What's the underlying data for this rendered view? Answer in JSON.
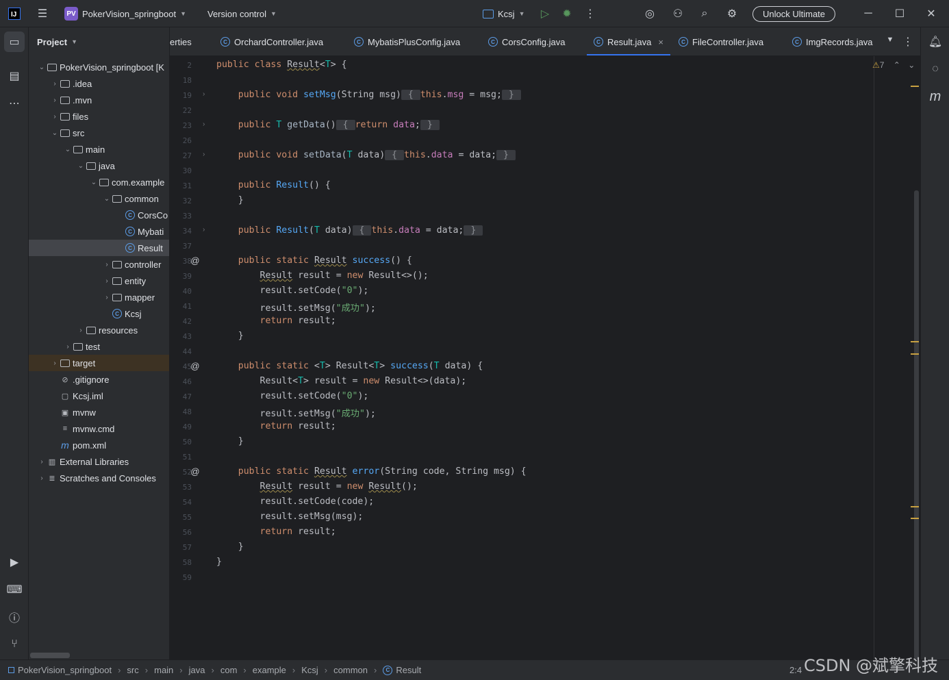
{
  "titlebar": {
    "project_badge": "PV",
    "project_name": "PokerVision_springboot",
    "vcs": "Version control",
    "run_config": "Kcsj",
    "unlock": "Unlock Ultimate"
  },
  "project_panel": {
    "title": "Project",
    "tree": [
      {
        "label": "PokerVision_springboot [K",
        "arrow": "open",
        "icon": "module",
        "indent": 0
      },
      {
        "label": ".idea",
        "arrow": "closed",
        "icon": "folder",
        "indent": 1
      },
      {
        "label": ".mvn",
        "arrow": "closed",
        "icon": "folder",
        "indent": 1
      },
      {
        "label": "files",
        "arrow": "closed",
        "icon": "folder",
        "indent": 1
      },
      {
        "label": "src",
        "arrow": "open",
        "icon": "folder",
        "indent": 1
      },
      {
        "label": "main",
        "arrow": "open",
        "icon": "folder",
        "indent": 2
      },
      {
        "label": "java",
        "arrow": "open",
        "icon": "folder",
        "indent": 3
      },
      {
        "label": "com.example",
        "arrow": "open",
        "icon": "package",
        "indent": 4
      },
      {
        "label": "common",
        "arrow": "open",
        "icon": "package",
        "indent": 5
      },
      {
        "label": "CorsCo",
        "arrow": "none",
        "icon": "class",
        "indent": 6
      },
      {
        "label": "Mybati",
        "arrow": "none",
        "icon": "class",
        "indent": 6
      },
      {
        "label": "Result",
        "arrow": "none",
        "icon": "class",
        "indent": 6,
        "selected": true
      },
      {
        "label": "controller",
        "arrow": "closed",
        "icon": "package",
        "indent": 5
      },
      {
        "label": "entity",
        "arrow": "closed",
        "icon": "package",
        "indent": 5
      },
      {
        "label": "mapper",
        "arrow": "closed",
        "icon": "package",
        "indent": 5
      },
      {
        "label": "Kcsj",
        "arrow": "none",
        "icon": "class",
        "indent": 5
      },
      {
        "label": "resources",
        "arrow": "closed",
        "icon": "folder",
        "indent": 3
      },
      {
        "label": "test",
        "arrow": "closed",
        "icon": "folder",
        "indent": 2
      },
      {
        "label": "target",
        "arrow": "closed",
        "icon": "folder",
        "indent": 1,
        "excluded": true
      },
      {
        "label": ".gitignore",
        "arrow": "none",
        "icon": "ignore",
        "indent": 1
      },
      {
        "label": "Kcsj.iml",
        "arrow": "none",
        "icon": "file",
        "indent": 1
      },
      {
        "label": "mvnw",
        "arrow": "none",
        "icon": "shell",
        "indent": 1
      },
      {
        "label": "mvnw.cmd",
        "arrow": "none",
        "icon": "text",
        "indent": 1
      },
      {
        "label": "pom.xml",
        "arrow": "none",
        "icon": "maven",
        "indent": 1
      },
      {
        "label": "External Libraries",
        "arrow": "closed",
        "icon": "library",
        "indent": 0
      },
      {
        "label": "Scratches and Consoles",
        "arrow": "closed",
        "icon": "scratch",
        "indent": 0
      }
    ]
  },
  "tabs": [
    {
      "label": "erties",
      "active": false
    },
    {
      "label": "OrchardController.java",
      "active": false
    },
    {
      "label": "MybatisPlusConfig.java",
      "active": false
    },
    {
      "label": "CorsConfig.java",
      "active": false
    },
    {
      "label": "Result.java",
      "active": true
    },
    {
      "label": "FileController.java",
      "active": false
    },
    {
      "label": "ImgRecords.java",
      "active": false
    }
  ],
  "editor": {
    "warning_count": "7",
    "lines": [
      {
        "n": "2",
        "fold": "",
        "at": false,
        "html": "<span class='kw'>public class</span> <span class='ul'>Result</span>&lt;<span class='tp'>T</span>&gt; {"
      },
      {
        "n": "18",
        "fold": "",
        "at": false,
        "html": ""
      },
      {
        "n": "19",
        "fold": "›",
        "at": false,
        "html": "    <span class='kw'>public void</span> <span class='fn'>setMsg</span>(String msg)<span class='fold-blk'> { </span><span class='kw'>this</span>.<span class='fld'>msg</span> = msg;<span class='fold-blk'> } </span>"
      },
      {
        "n": "22",
        "fold": "",
        "at": false,
        "html": ""
      },
      {
        "n": "23",
        "fold": "›",
        "at": false,
        "html": "    <span class='kw'>public</span> <span class='tp'>T</span> <span class='dim'>getData</span>()<span class='fold-blk'> { </span><span class='kw'>return</span> <span class='fld'>data</span>;<span class='fold-blk'> } </span>"
      },
      {
        "n": "26",
        "fold": "",
        "at": false,
        "html": ""
      },
      {
        "n": "27",
        "fold": "›",
        "at": false,
        "html": "    <span class='kw'>public void</span> <span class='dim'>setData</span>(<span class='tp'>T</span> data)<span class='fold-blk'> { </span><span class='kw'>this</span>.<span class='fld'>data</span> = data;<span class='fold-blk'> } </span>"
      },
      {
        "n": "30",
        "fold": "",
        "at": false,
        "html": ""
      },
      {
        "n": "31",
        "fold": "",
        "at": false,
        "html": "    <span class='kw'>public</span> <span class='fn'>Result</span>() {"
      },
      {
        "n": "32",
        "fold": "",
        "at": false,
        "html": "    }"
      },
      {
        "n": "33",
        "fold": "",
        "at": false,
        "html": ""
      },
      {
        "n": "34",
        "fold": "›",
        "at": false,
        "html": "    <span class='kw'>public</span> <span class='fn'>Result</span>(<span class='tp'>T</span> data)<span class='fold-blk'> { </span><span class='kw'>this</span>.<span class='fld'>data</span> = data;<span class='fold-blk'> } </span>"
      },
      {
        "n": "37",
        "fold": "",
        "at": false,
        "html": ""
      },
      {
        "n": "38",
        "fold": "",
        "at": true,
        "html": "    <span class='kw'>public static</span> <span class='ul'>Result</span> <span class='fn'>success</span>() {"
      },
      {
        "n": "39",
        "fold": "",
        "at": false,
        "html": "        <span class='ul'>Result</span> result = <span class='kw'>new</span> Result&lt;&gt;();"
      },
      {
        "n": "40",
        "fold": "",
        "at": false,
        "html": "        result.setCode(<span class='str'>\"0\"</span>);"
      },
      {
        "n": "41",
        "fold": "",
        "at": false,
        "html": "        result.setMsg(<span class='str'>\"成功\"</span>);"
      },
      {
        "n": "42",
        "fold": "",
        "at": false,
        "html": "        <span class='kw'>return</span> result;"
      },
      {
        "n": "43",
        "fold": "",
        "at": false,
        "html": "    }"
      },
      {
        "n": "44",
        "fold": "",
        "at": false,
        "html": ""
      },
      {
        "n": "45",
        "fold": "",
        "at": true,
        "html": "    <span class='kw'>public static</span> &lt;<span class='tp'>T</span>&gt; Result&lt;<span class='tp'>T</span>&gt; <span class='fn'>success</span>(<span class='tp'>T</span> data) {"
      },
      {
        "n": "46",
        "fold": "",
        "at": false,
        "html": "        Result&lt;<span class='tp'>T</span>&gt; result = <span class='kw'>new</span> Result&lt;&gt;(data);"
      },
      {
        "n": "47",
        "fold": "",
        "at": false,
        "html": "        result.setCode(<span class='str'>\"0\"</span>);"
      },
      {
        "n": "48",
        "fold": "",
        "at": false,
        "html": "        result.setMsg(<span class='str'>\"成功\"</span>);"
      },
      {
        "n": "49",
        "fold": "",
        "at": false,
        "html": "        <span class='kw'>return</span> result;"
      },
      {
        "n": "50",
        "fold": "",
        "at": false,
        "html": "    }"
      },
      {
        "n": "51",
        "fold": "",
        "at": false,
        "html": ""
      },
      {
        "n": "52",
        "fold": "",
        "at": true,
        "html": "    <span class='kw'>public static</span> <span class='ul'>Result</span> <span class='fn'>error</span>(String code, String msg) {"
      },
      {
        "n": "53",
        "fold": "",
        "at": false,
        "html": "        <span class='ul'>Result</span> result = <span class='kw'>new</span> <span class='ul'>Result</span>();"
      },
      {
        "n": "54",
        "fold": "",
        "at": false,
        "html": "        result.setCode(code);"
      },
      {
        "n": "55",
        "fold": "",
        "at": false,
        "html": "        result.setMsg(msg);"
      },
      {
        "n": "56",
        "fold": "",
        "at": false,
        "html": "        <span class='kw'>return</span> result;"
      },
      {
        "n": "57",
        "fold": "",
        "at": false,
        "html": "    }"
      },
      {
        "n": "58",
        "fold": "",
        "at": false,
        "html": "}"
      },
      {
        "n": "59",
        "fold": "",
        "at": false,
        "html": ""
      }
    ]
  },
  "statusbar": {
    "breadcrumb": [
      "PokerVision_springboot",
      "src",
      "main",
      "java",
      "com",
      "example",
      "Kcsj",
      "common",
      "Result"
    ],
    "position": "2:4",
    "watermark": "CSDN @斌擎科技"
  }
}
